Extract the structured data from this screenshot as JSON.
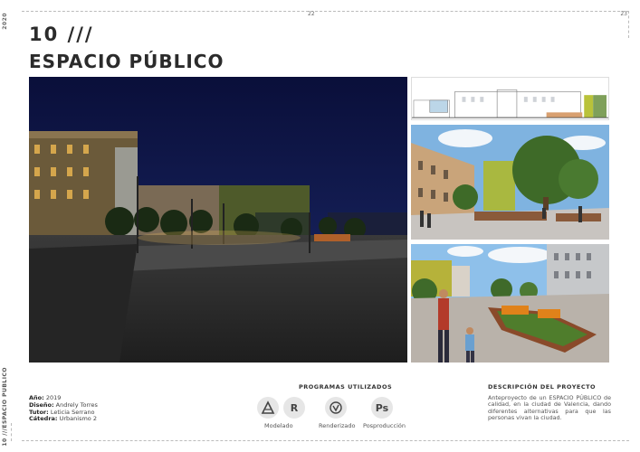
{
  "frame": {
    "year": "2020",
    "page_left": "22",
    "page_right": "23",
    "section_side": "10 ///ESPACIO PÚBLICO"
  },
  "header": {
    "number": "10 ///",
    "title": "ESPACIO PÚBLICO"
  },
  "credits": [
    {
      "label": "Año:",
      "value": "2019"
    },
    {
      "label": "Diseño:",
      "value": "Andrely Torres"
    },
    {
      "label": "Tutor:",
      "value": "Leticia Serrano"
    },
    {
      "label": "Cátedra:",
      "value": "Urbanismo 2"
    }
  ],
  "programs": {
    "title": "PROGRAMAS UTILIZADOS",
    "icons": [
      {
        "name": "autocad-icon",
        "glyph": "A"
      },
      {
        "name": "revit-icon",
        "glyph": "R"
      },
      {
        "name": "vray-icon",
        "glyph": "V"
      },
      {
        "name": "photoshop-icon",
        "glyph": "Ps"
      }
    ],
    "labels": [
      "Modelado",
      "Renderizado",
      "Posproducción"
    ]
  },
  "description": {
    "title": "DESCRIPCIÓN DEL PROYECTO",
    "text": "Anteproyecto de un ESPACIO PÚBLICO de calidad, en la ciudad de Valencia, dando diferentes alternativas para que las personas vivan la ciudad."
  }
}
